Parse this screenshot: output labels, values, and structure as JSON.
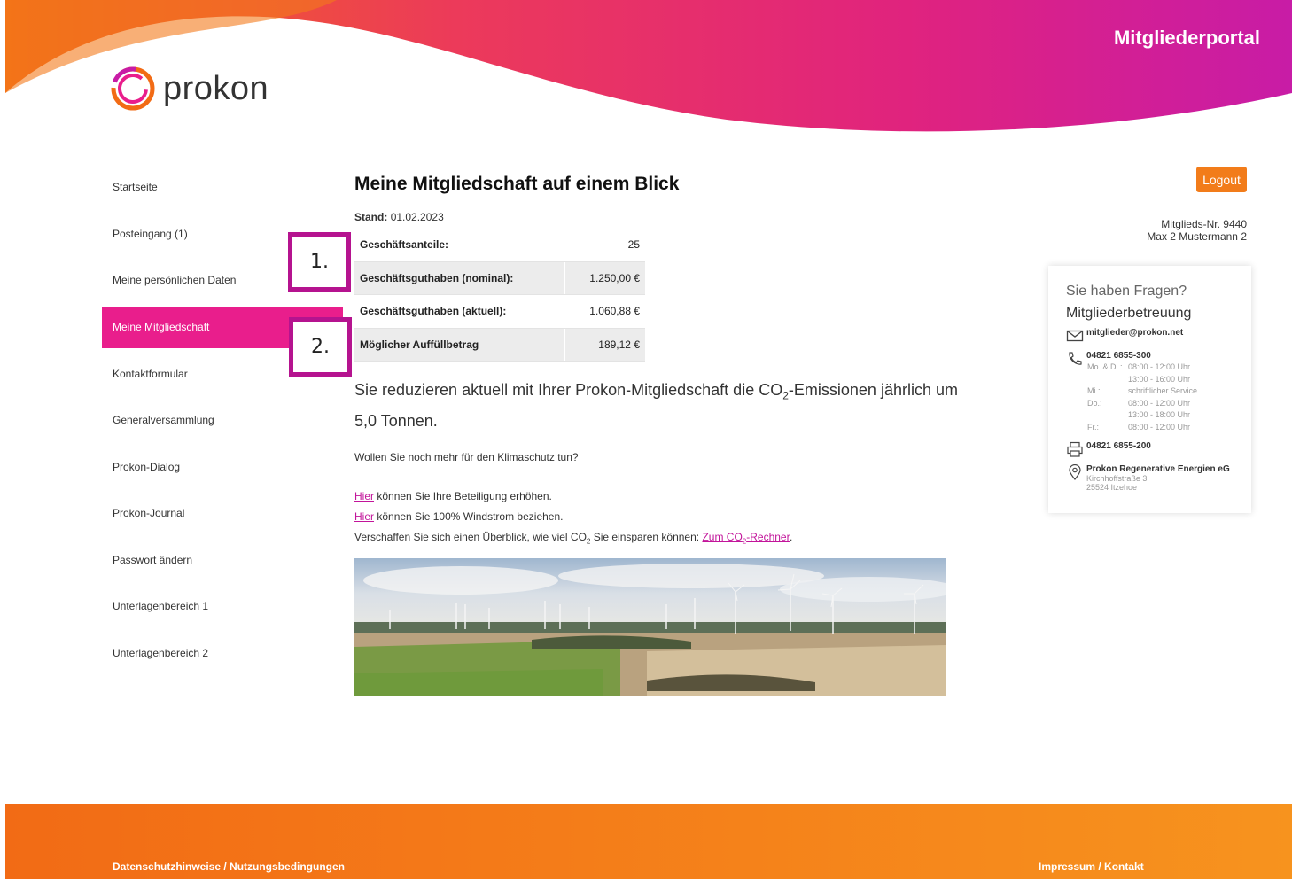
{
  "header": {
    "logo_text": "prokon",
    "portal_title": "Mitgliederportal"
  },
  "colors": {
    "accent_pink": "#e91e8c",
    "accent_orange": "#f27c1a",
    "marker_border": "#b5138f"
  },
  "sidebar": {
    "items": [
      {
        "label": "Startseite"
      },
      {
        "label": "Posteingang (1)"
      },
      {
        "label": "Meine persönlichen Daten"
      },
      {
        "label": "Meine Mitgliedschaft",
        "active": true
      },
      {
        "label": "Kontaktformular"
      },
      {
        "label": "Generalversammlung"
      },
      {
        "label": "Prokon-Dialog"
      },
      {
        "label": "Prokon-Journal"
      },
      {
        "label": "Passwort ändern"
      },
      {
        "label": "Unterlagenbereich 1"
      },
      {
        "label": "Unterlagenbereich 2"
      }
    ]
  },
  "markers": {
    "one": "1.",
    "two": "2."
  },
  "main": {
    "title": "Meine Mitgliedschaft auf einem Blick",
    "stand_label": "Stand:",
    "stand_date": "01.02.2023",
    "table": [
      {
        "label": "Geschäftsanteile:",
        "value": "25"
      },
      {
        "label": "Geschäftsguthaben (nominal):",
        "value": "1.250,00 €"
      },
      {
        "label": "Geschäftsguthaben (aktuell):",
        "value": "1.060,88 €"
      },
      {
        "label": "Möglicher Auffüllbetrag",
        "value": "189,12 €"
      }
    ],
    "co2_part1": "Sie reduzieren aktuell mit Ihrer Prokon-Mitgliedschaft die CO",
    "co2_sub": "2",
    "co2_part2": "-Emissionen jährlich um 5,0 Tonnen.",
    "question": "Wollen Sie noch mehr für den Klimaschutz tun?",
    "link1_anchor": "Hier",
    "link1_text": " können Sie Ihre Beteiligung erhöhen.",
    "link2_anchor": "Hier",
    "link2_text": " können Sie 100% Windstrom beziehen.",
    "line3_text": "Verschaffen Sie sich einen Überblick, wie viel CO",
    "line3_sub": "2",
    "line3_text2": " Sie einsparen können: ",
    "line3_link": "Zum CO",
    "line3_link_sub": "2",
    "line3_link2": "-Rechner",
    "line3_end": "."
  },
  "account": {
    "logout_label": "Logout",
    "member_no": "Mitglieds-Nr. 9440",
    "member_name": "Max 2 Mustermann 2"
  },
  "contact_card": {
    "question": "Sie haben Fragen?",
    "subtitle": "Mitgliederbetreuung",
    "email": "mitglieder@prokon.net",
    "phone": "04821 6855-300",
    "hours": [
      {
        "day": "Mo. & Di.:",
        "time": "08:00 - 12:00 Uhr"
      },
      {
        "day": "",
        "time": "13:00 - 16:00 Uhr"
      },
      {
        "day": "Mi.:",
        "time": "schriftlicher Service"
      },
      {
        "day": "Do.:",
        "time": "08:00 - 12:00 Uhr"
      },
      {
        "day": "",
        "time": "13:00 - 18:00 Uhr"
      },
      {
        "day": "Fr.:",
        "time": "08:00 - 12:00 Uhr"
      }
    ],
    "fax": "04821 6855-200",
    "company": "Prokon Regenerative Energien eG",
    "street": "Kirchhoffstraße 3",
    "city": "25524 Itzehoe"
  },
  "footer": {
    "left_link": "Datenschutzhinweise / Nutzungsbedingungen",
    "right_link": "Impressum / Kontakt"
  }
}
